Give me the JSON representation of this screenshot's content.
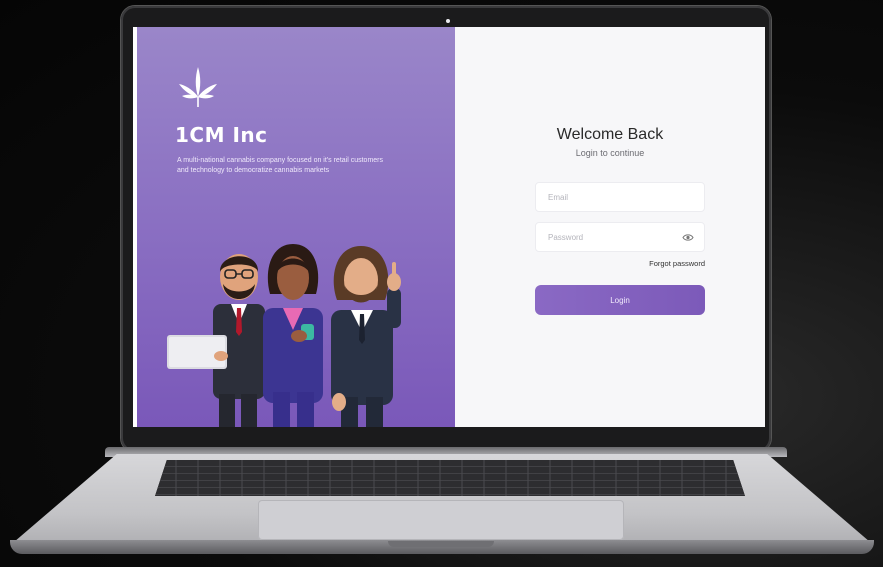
{
  "brand": {
    "name": "1CM Inc",
    "tagline": "A multi-national cannabis company focused on it's retail customers and technology to democratize cannabis markets",
    "logo_icon": "cannabis-leaf-icon"
  },
  "login": {
    "title": "Welcome Back",
    "subtitle": "Login to continue",
    "email_placeholder": "Email",
    "password_placeholder": "Password",
    "forgot_label": "Forgot password",
    "submit_label": "Login",
    "eye_icon": "eye-icon"
  },
  "colors": {
    "accent": "#7c5ab9",
    "panel_top": "#9a86c9",
    "panel_bottom": "#7a58b9",
    "form_bg": "#f7f7f9"
  }
}
